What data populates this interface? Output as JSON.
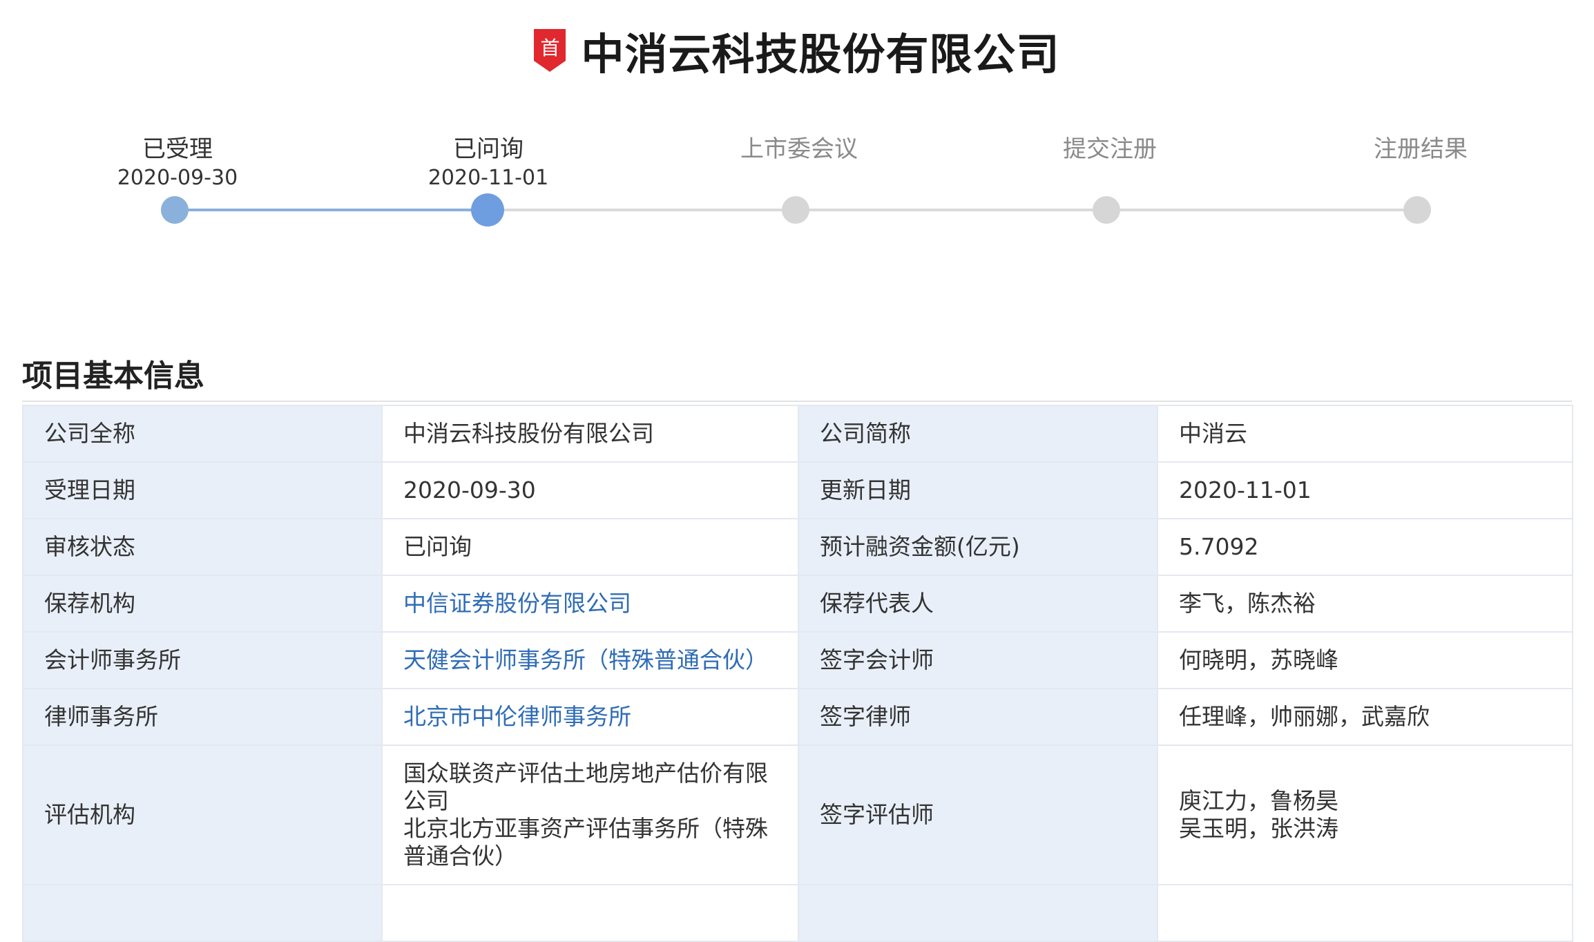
{
  "header": {
    "badge_text": "首",
    "badge_color": "#e0282e",
    "company_title": "中消云科技股份有限公司"
  },
  "timeline": {
    "steps": [
      {
        "label": "已受理",
        "date": "2020-09-30",
        "state": "done"
      },
      {
        "label": "已问询",
        "date": "2020-11-01",
        "state": "current"
      },
      {
        "label": "上市委会议",
        "date": "",
        "state": "pending"
      },
      {
        "label": "提交注册",
        "date": "",
        "state": "pending"
      },
      {
        "label": "注册结果",
        "date": "",
        "state": "pending"
      }
    ],
    "colors": {
      "done": "#8ab0dc",
      "current": "#6f9ee0",
      "pending": "#d6d6d6"
    }
  },
  "section": {
    "title": "项目基本信息"
  },
  "info_table": {
    "rows": [
      {
        "k1": "公司全称",
        "v1": "中消云科技股份有限公司",
        "k2": "公司简称",
        "v2": "中消云"
      },
      {
        "k1": "受理日期",
        "v1": "2020-09-30",
        "k2": "更新日期",
        "v2": "2020-11-01"
      },
      {
        "k1": "审核状态",
        "v1": "已问询",
        "k2": "预计融资金额(亿元)",
        "v2": "5.7092"
      },
      {
        "k1": "保荐机构",
        "v1": "中信证券股份有限公司",
        "k2": "保荐代表人",
        "v2": "李飞，陈杰裕"
      },
      {
        "k1": "会计师事务所",
        "v1": "天健会计师事务所（特殊普通合伙）",
        "k2": "签字会计师",
        "v2": "何晓明，苏晓峰"
      },
      {
        "k1": "律师事务所",
        "v1": "北京市中伦律师事务所",
        "k2": "签字律师",
        "v2": "任理峰，帅丽娜，武嘉欣"
      },
      {
        "k1": "评估机构",
        "v1_lines": [
          "国众联资产评估土地房地产估价有限公司",
          "北京北方亚事资产评估事务所（特殊普通合伙）"
        ],
        "k2": "签字评估师",
        "v2_lines": [
          "庾江力，鲁杨昊",
          "吴玉明，张洪涛"
        ]
      }
    ],
    "link_color": "#2f6cb5"
  }
}
